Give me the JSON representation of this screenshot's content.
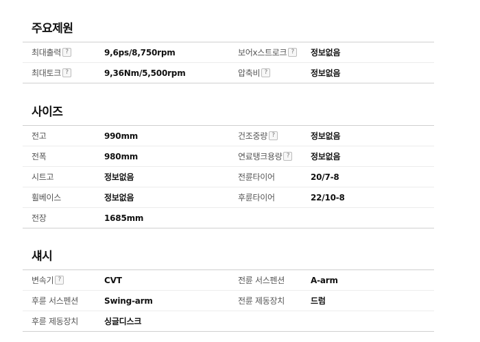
{
  "sections": [
    {
      "title": "주요제원",
      "rows": [
        {
          "l1": "최대출력",
          "h1": true,
          "v1": "9,6ps/8,750rpm",
          "l2": "보어x스트로크",
          "h2": true,
          "v2": "정보없음"
        },
        {
          "l1": "최대토크",
          "h1": true,
          "v1": "9,36Nm/5,500rpm",
          "l2": "압축비",
          "h2": true,
          "v2": "정보없음"
        }
      ]
    },
    {
      "title": "사이즈",
      "rows": [
        {
          "l1": "전고",
          "h1": false,
          "v1": "990mm",
          "l2": "건조중량",
          "h2": true,
          "v2": "정보없음"
        },
        {
          "l1": "전폭",
          "h1": false,
          "v1": "980mm",
          "l2": "연료탱크용량",
          "h2": true,
          "v2": "정보없음"
        },
        {
          "l1": "시트고",
          "h1": false,
          "v1": "정보없음",
          "l2": "전륜타이어",
          "h2": false,
          "v2": "20/7-8"
        },
        {
          "l1": "휠베이스",
          "h1": false,
          "v1": "정보없음",
          "l2": "후륜타이어",
          "h2": false,
          "v2": "22/10-8"
        },
        {
          "l1": "전장",
          "h1": false,
          "v1": "1685mm",
          "l2": "",
          "h2": false,
          "v2": ""
        }
      ]
    },
    {
      "title": "섀시",
      "rows": [
        {
          "l1": "변속기",
          "h1": true,
          "v1": "CVT",
          "l2": "전륜 서스펜션",
          "h2": false,
          "v2": "A-arm"
        },
        {
          "l1": "후륜 서스펜션",
          "h1": false,
          "v1": "Swing-arm",
          "l2": "전륜 제동장치",
          "h2": false,
          "v2": "드럼"
        },
        {
          "l1": "후륜 제동장치",
          "h1": false,
          "v1": "싱글디스크",
          "l2": "",
          "h2": false,
          "v2": ""
        }
      ]
    }
  ],
  "help_glyph": "?"
}
